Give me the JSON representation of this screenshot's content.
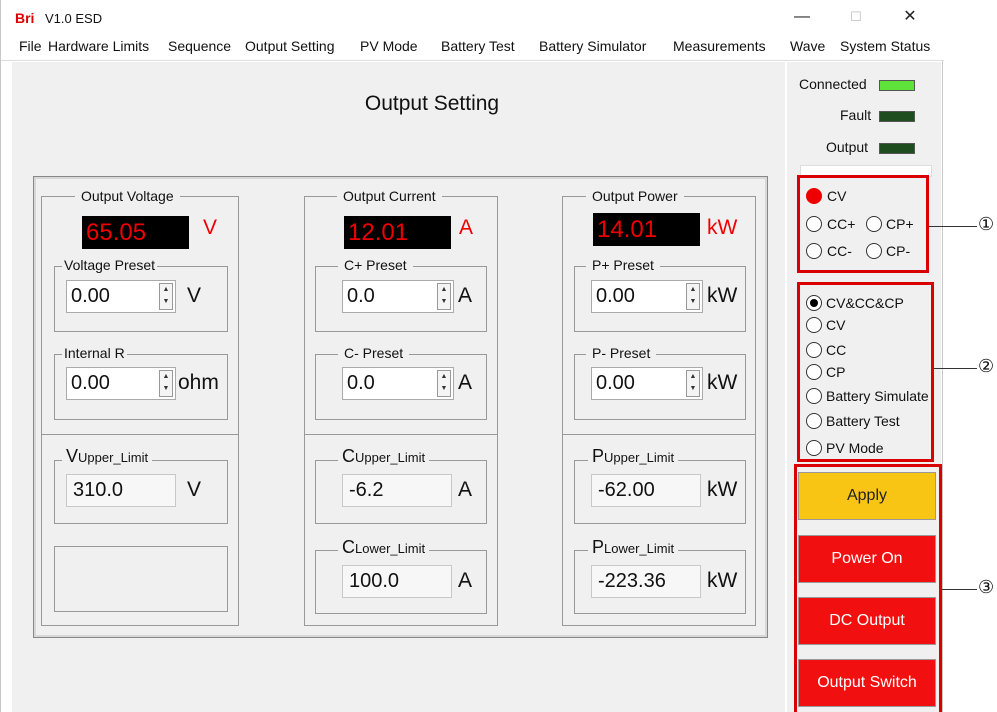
{
  "app": {
    "logo": "Bri",
    "title": "V1.0  ESD"
  },
  "window_controls": {
    "minimize": "—",
    "maximize": "☐",
    "close": "✕"
  },
  "menu": [
    "File",
    "Hardware Limits",
    "Sequence",
    "Output Setting",
    "PV Mode",
    "Battery Test",
    "Battery Simulator",
    "Measurements",
    "Wave",
    "System Status"
  ],
  "page_title": "Output Setting",
  "voltage": {
    "title": "Output Voltage",
    "value": "65.05",
    "unit": "V",
    "preset_title": "Voltage Preset",
    "preset_value": "0.00",
    "preset_unit": "V",
    "internal_r_title": "Internal R",
    "internal_r_value": "0.00",
    "internal_r_unit": "ohm",
    "upper_limit": {
      "main": "V",
      "sub": "Upper_Limit",
      "value": "310.0",
      "unit": "V"
    }
  },
  "current": {
    "title": "Output Current",
    "value": "12.01",
    "unit": "A",
    "cplus_title": "C+ Preset",
    "cplus_value": "0.0",
    "cplus_unit": "A",
    "cminus_title": "C- Preset",
    "cminus_value": "0.0",
    "cminus_unit": "A",
    "upper_limit": {
      "main": "C",
      "sub": "Upper_Limit",
      "value": "-6.2",
      "unit": "A"
    },
    "lower_limit": {
      "main": "C",
      "sub": "Lower_Limit",
      "value": "100.0",
      "unit": "A"
    }
  },
  "power": {
    "title": "Output Power",
    "value": "14.01",
    "unit": "kW",
    "pplus_title": "P+ Preset",
    "pplus_value": "0.00",
    "pplus_unit": "kW",
    "pminus_title": "P- Preset",
    "pminus_value": "0.00",
    "pminus_unit": "kW",
    "upper_limit": {
      "main": "P",
      "sub": "Upper_Limit",
      "value": "-62.00",
      "unit": "kW"
    },
    "lower_limit": {
      "main": "P",
      "sub": "Lower_Limit",
      "value": "-223.36",
      "unit": "kW"
    }
  },
  "status": {
    "connected": {
      "label": "Connected",
      "color": "#5fe33a"
    },
    "fault": {
      "label": "Fault",
      "color": "#1f4d1f"
    },
    "output": {
      "label": "Output",
      "color": "#1f4d1f"
    }
  },
  "control_mode": {
    "options": [
      "CV",
      "CC+",
      "CP+",
      "CC-",
      "CP-"
    ],
    "selected": "CV"
  },
  "operating_mode": {
    "options": [
      "CV&CC&CP",
      "CV",
      "CC",
      "CP",
      "Battery Simulate",
      "Battery Test",
      "PV Mode"
    ],
    "selected": "CV&CC&CP"
  },
  "buttons": {
    "apply": "Apply",
    "power_on": "Power On",
    "dc_output": "DC Output",
    "output_switch": "Output Switch"
  },
  "callouts": [
    "①",
    "②",
    "③"
  ],
  "colors": {
    "apply_bg": "#f9c514",
    "action_red": "#f20f0f",
    "callout_red": "#d80000"
  }
}
